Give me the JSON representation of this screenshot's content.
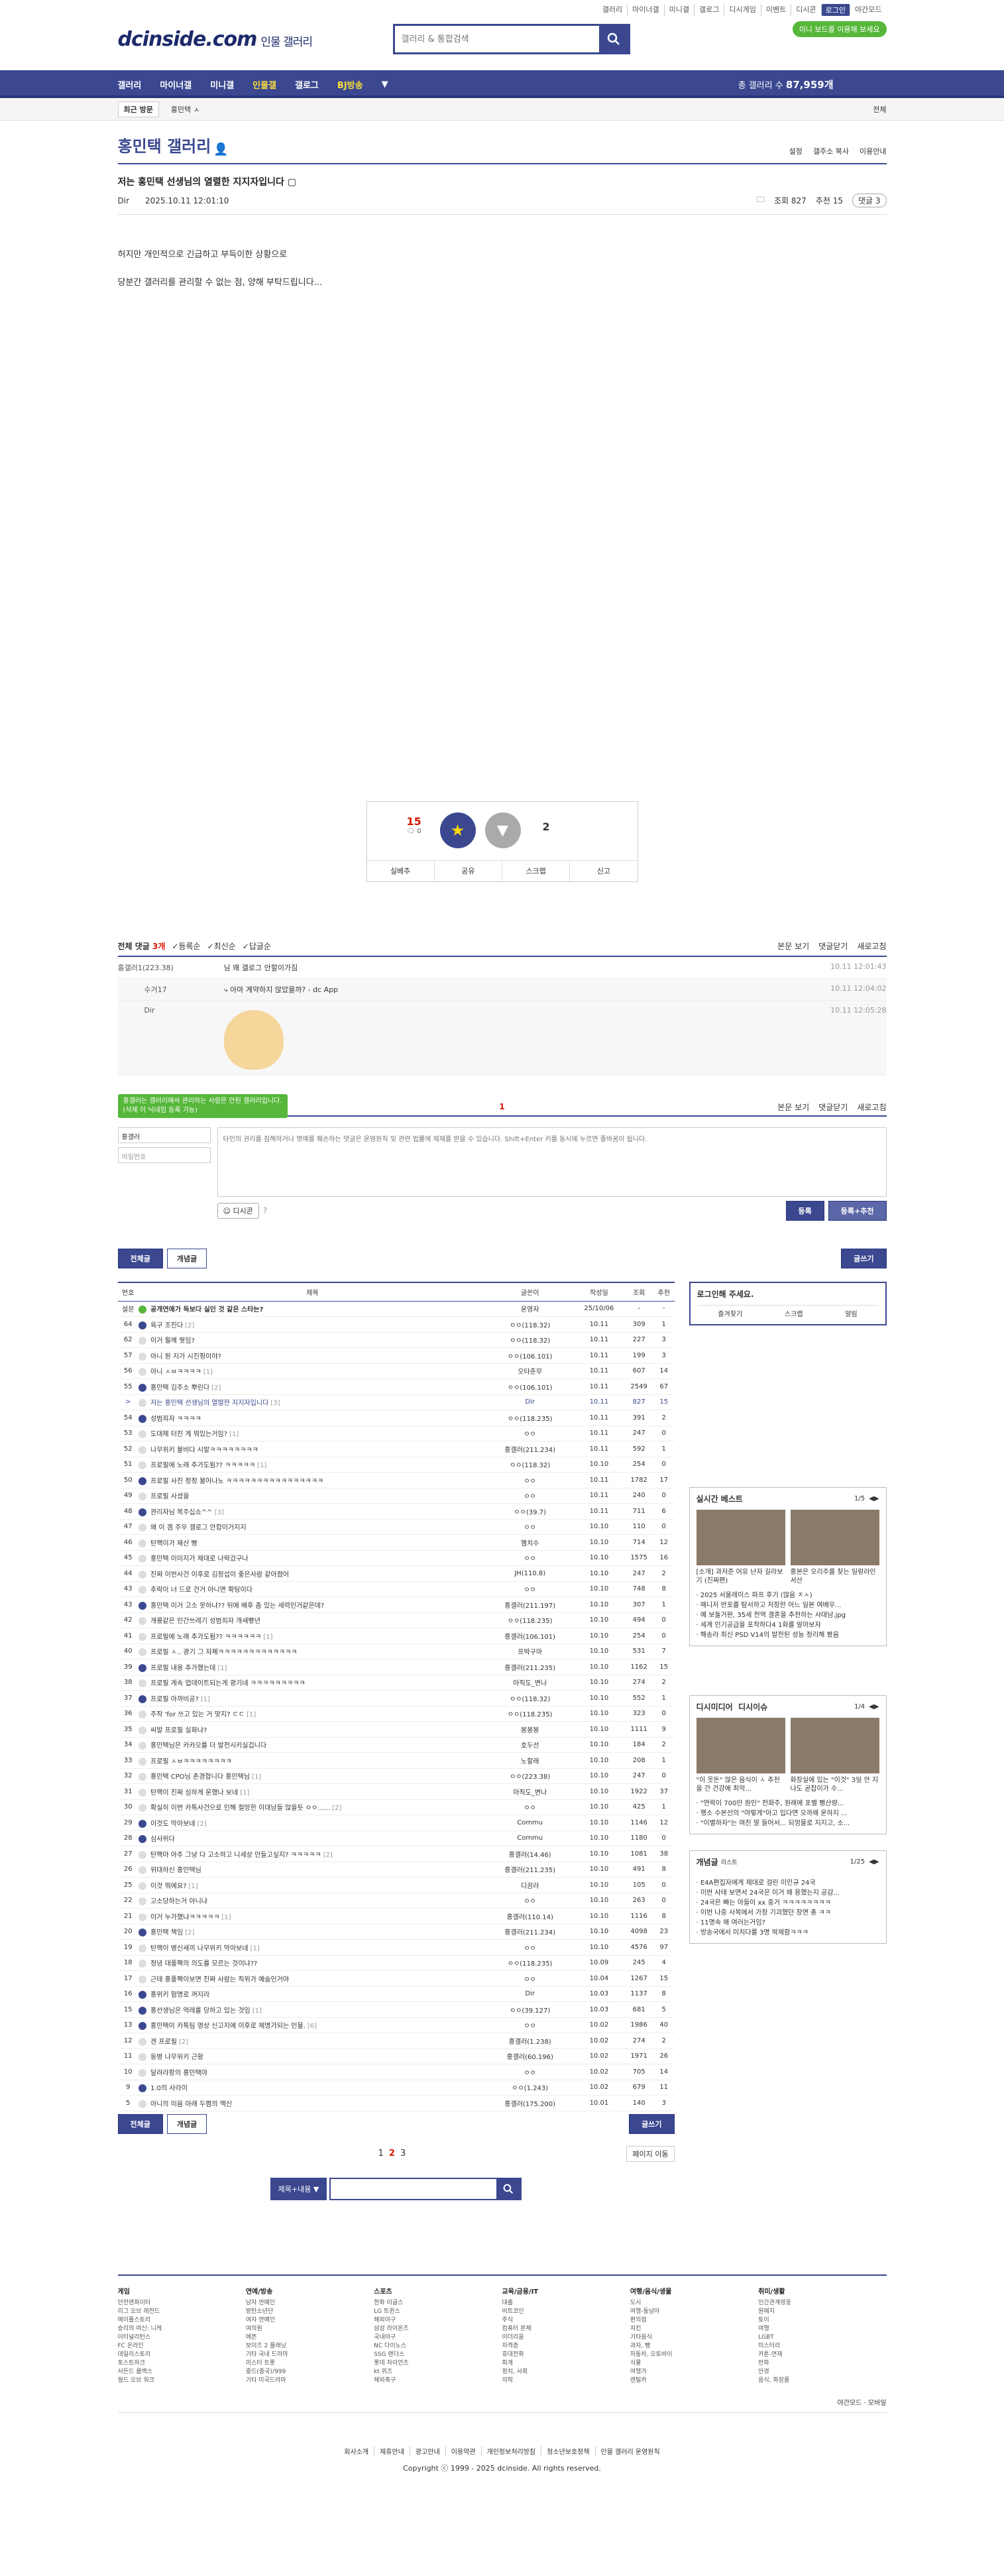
{
  "util_nav": [
    "갤러리",
    "마이너갤",
    "미니갤",
    "갤로그",
    "디시게임",
    "이벤트",
    "디시콘",
    "로그인",
    "야간모드"
  ],
  "logo": {
    "main": "dcinside.com",
    "sub": "인물 갤러리"
  },
  "search": {
    "placeholder": "갤러리 & 통합검색"
  },
  "mini_bubble": "미니 보드를 이용해 보세요",
  "gnb": {
    "items": [
      "갤러리",
      "마이너갤",
      "미니갤",
      "인물갤",
      "갤로그",
      "BJ방송"
    ],
    "count_label": "총 갤러리 수",
    "count_value": "87,959개"
  },
  "visit": {
    "title": "최근 방문",
    "item": "홍민택 ㅅ",
    "all": "전체"
  },
  "gallery": {
    "title": "홍민택 갤러리",
    "opts": [
      "설정",
      "갤주소 복사",
      "이용안내"
    ]
  },
  "post": {
    "title": "저는 홍민택 선생님의 열렬한 지지자입니다",
    "author": "Dir",
    "date": "2025.10.11 12:01:10",
    "views": "조회 827",
    "recommends": "추천 15",
    "comment_btn": "댓글 3",
    "body": [
      "허지만 개인적으로 긴급하고 부득이한 상황으로",
      "당분간 갤러리를 관리할 수 없는 점, 양해 부탁드립니다..."
    ]
  },
  "vote": {
    "up": "15",
    "up_sub": "0",
    "up_label": "개념",
    "down_label": "비추",
    "down": "2",
    "actions": [
      "실베추",
      "공유",
      "스크랩",
      "신고"
    ]
  },
  "comments": {
    "header": "전체 댓글",
    "count": "3개",
    "sorts": [
      "등록순",
      "최신순",
      "답글순"
    ],
    "right": [
      "본문 보기",
      "댓글닫기",
      "새로고침"
    ],
    "items": [
      {
        "who": "홍갤러1(223.38)",
        "text": "님 왜 갤로그 안할이가짐",
        "date": "10.11 12:01:43",
        "reply": false
      },
      {
        "who": "수거17",
        "text": "아마 계약하지 않았을까? - dc App",
        "date": "10.11 12:04:02",
        "reply": true
      },
      {
        "who": "Dir",
        "text": "",
        "date": "10.11 12:05:28",
        "reply": true
      }
    ],
    "page": "1",
    "tip": "홍갤러는 갤러리에서 관리하는 사람은 안된 갤러리입니다. (삭제 이 닉네임 등록 가능)",
    "nick_placeholder": "홍갤러",
    "pw_placeholder": "비밀번호",
    "textarea_placeholder": "타인의 권리를 침해하거나 명예를 훼손하는 댓글은 운영원칙 및 관련 법률에 제재를 받을 수 있습니다. Shift+Enter 키를 동시에 누르면 줄바꿈이 됩니다.",
    "dccon": "디시콘",
    "submit": "등록",
    "submit_rec": "등록+추천"
  },
  "list_buttons": {
    "all": "전체글",
    "concept": "개념글",
    "write": "글쓰기"
  },
  "table": {
    "headers": [
      "번호",
      "제목",
      "글쓴이",
      "작성일",
      "조회",
      "추천"
    ],
    "rows": [
      {
        "no": "설문",
        "title": "공개연애가 득보다 실인 것 같은 스타는?",
        "cc": "",
        "writer": "운영자",
        "date": "25/10/06",
        "views": "-",
        "rec": "-",
        "notice": true,
        "icon": "g"
      },
      {
        "no": "64",
        "title": "육구 조진다",
        "cc": "[2]",
        "writer": "ㅇㅇ(118.32)",
        "date": "10.11",
        "views": "309",
        "rec": "1",
        "icon": "b"
      },
      {
        "no": "62",
        "title": "이거 뭘께 뭣임?",
        "cc": "",
        "writer": "ㅇㅇ(118.32)",
        "date": "10.11",
        "views": "227",
        "rec": "3",
        "icon": ""
      },
      {
        "no": "57",
        "title": "아니 뭔 지가 시진핑이야?",
        "cc": "",
        "writer": "ㅇㅇ(106.101)",
        "date": "10.11",
        "views": "199",
        "rec": "3",
        "icon": ""
      },
      {
        "no": "56",
        "title": "아니 ㅅㅂㅋㅋㅋㅋ",
        "cc": "[1]",
        "writer": "오타춘무",
        "date": "10.11",
        "views": "607",
        "rec": "14",
        "icon": ""
      },
      {
        "no": "55",
        "title": "홍민택 김주소 뿌린다",
        "cc": "[2]",
        "writer": "ㅇㅇ(106.101)",
        "date": "10.11",
        "views": "2549",
        "rec": "67",
        "icon": "b"
      },
      {
        "no": ">",
        "title": "저는 홍민택 선생님의 열렬한 지지자입니다",
        "cc": "[3]",
        "writer": "Dir",
        "date": "10.11",
        "views": "827",
        "rec": "15",
        "cur": true,
        "icon": ""
      },
      {
        "no": "54",
        "title": "성범죄자 ㅋㅋㅋㅋ",
        "cc": "",
        "writer": "ㅇㅇ(118.235)",
        "date": "10.11",
        "views": "391",
        "rec": "2",
        "icon": "b"
      },
      {
        "no": "53",
        "title": "도대체 터진 게 뭐있는거임?",
        "cc": "[1]",
        "writer": "ㅇㅇ",
        "date": "10.11",
        "views": "247",
        "rec": "0",
        "icon": ""
      },
      {
        "no": "52",
        "title": "나무위키 불비다 시발ㅋㅋㅋㅋㅋㅋㅋㅋ",
        "cc": "",
        "writer": "홍갤러(211.234)",
        "date": "10.11",
        "views": "592",
        "rec": "1",
        "icon": ""
      },
      {
        "no": "51",
        "title": "프로필에 노래 추가도됨?? ㅋㅋㅋㅋㅋ",
        "cc": "[1]",
        "writer": "ㅇㅇ(118.32)",
        "date": "10.10",
        "views": "254",
        "rec": "0",
        "icon": ""
      },
      {
        "no": "50",
        "title": "프로필 사진 정정 불어나노 ㅋㅋㅋㅋㅋㅋㅋㅋㅋㅋㅋㅋㅋㅋㅋㅋ",
        "cc": "",
        "writer": "ㅇㅇ",
        "date": "10.11",
        "views": "1782",
        "rec": "17",
        "icon": "b"
      },
      {
        "no": "49",
        "title": "프로필 사셨을",
        "cc": "",
        "writer": "ㅇㅇ",
        "date": "10.11",
        "views": "240",
        "rec": "0",
        "icon": ""
      },
      {
        "no": "48",
        "title": "관리자님 복주십쇼^^",
        "cc": "[3]",
        "writer": "ㅇㅇ(39.7)",
        "date": "10.11",
        "views": "711",
        "rec": "6",
        "icon": "b"
      },
      {
        "no": "47",
        "title": "왜 이 겜 주우 갤로그 안합이거지지",
        "cc": "",
        "writer": "ㅇㅇ",
        "date": "10.10",
        "views": "110",
        "rec": "0",
        "icon": ""
      },
      {
        "no": "46",
        "title": "탄핵이가 재산 빵",
        "cc": "",
        "writer": "햄치수",
        "date": "10.10",
        "views": "714",
        "rec": "12",
        "icon": ""
      },
      {
        "no": "45",
        "title": "홍민택 이미지가 제대로 나락갔구나",
        "cc": "",
        "writer": "ㅇㅇ",
        "date": "10.10",
        "views": "1575",
        "rec": "16",
        "icon": ""
      },
      {
        "no": "44",
        "title": "진짜 이번사건 이후로 김정섭이 좋은사람 같아졌어",
        "cc": "",
        "writer": "JH(110.8)",
        "date": "10.10",
        "views": "247",
        "rec": "2",
        "icon": ""
      },
      {
        "no": "43",
        "title": "추락이 너 드로 건거 아니면 확팅이다",
        "cc": "",
        "writer": "ㅇㅇ",
        "date": "10.10",
        "views": "748",
        "rec": "8",
        "icon": ""
      },
      {
        "no": "43",
        "title": "홍민택 이거 고소 못하냐?? 뒤에 배후 좀 있는 세력인거같은데?",
        "cc": "",
        "writer": "홍갤러(211.197)",
        "date": "10.10",
        "views": "307",
        "rec": "1",
        "icon": "b"
      },
      {
        "no": "42",
        "title": "개룡같은 인간쓰레기 성범죄자 개새빵년",
        "cc": "",
        "writer": "ㅇㅇ(118.235)",
        "date": "10.10",
        "views": "494",
        "rec": "0",
        "icon": ""
      },
      {
        "no": "41",
        "title": "프로필에 노래 추가도됨?? ㅋㅋㅋㅋㅋㅋ",
        "cc": "[1]",
        "writer": "홍갤러(106.101)",
        "date": "10.10",
        "views": "254",
        "rec": "0",
        "icon": ""
      },
      {
        "no": "40",
        "title": "프로필 ㅅ.. 광기 그 자체ㅋㅋㅋㅋㅋㅋㅋㅋㅋㅋㅋㅋㅋ",
        "cc": "",
        "writer": "프박구마",
        "date": "10.10",
        "views": "531",
        "rec": "7",
        "icon": ""
      },
      {
        "no": "39",
        "title": "프로필 내용 추가했는데",
        "cc": "[1]",
        "writer": "홍갤러(211.235)",
        "date": "10.10",
        "views": "1162",
        "rec": "15",
        "icon": "b"
      },
      {
        "no": "38",
        "title": "프로필 게속 업데이트되는게 광기네 ㅋㅋㅋㅋㅋㅋㅋㅋㅋ",
        "cc": "",
        "writer": "아직도_변나",
        "date": "10.10",
        "views": "274",
        "rec": "2",
        "icon": ""
      },
      {
        "no": "37",
        "title": "프로필 아까비공?",
        "cc": "[1]",
        "writer": "ㅇㅇ(118.32)",
        "date": "10.10",
        "views": "552",
        "rec": "1",
        "icon": "b"
      },
      {
        "no": "36",
        "title": "주작 'for 쓰고 있는 거 맞지? ㄷㄷ",
        "cc": "[1]",
        "writer": "ㅇㅇ(118.235)",
        "date": "10.10",
        "views": "323",
        "rec": "0",
        "icon": ""
      },
      {
        "no": "35",
        "title": "씨발 프로필 실화냐?",
        "cc": "",
        "writer": "봉봉봉",
        "date": "10.10",
        "views": "1111",
        "rec": "9",
        "icon": ""
      },
      {
        "no": "34",
        "title": "홍민택님은 카카오를 더 발전시키실겁니다",
        "cc": "",
        "writer": "호두선",
        "date": "10.10",
        "views": "184",
        "rec": "2",
        "icon": ""
      },
      {
        "no": "33",
        "title": "프로필 ㅅㅂㅋㅋㅋㅋㅋㅋㅋㅋ",
        "cc": "",
        "writer": "노할래",
        "date": "10.10",
        "views": "208",
        "rec": "1",
        "icon": ""
      },
      {
        "no": "32",
        "title": "홍민택 CPO님 존경합니다 홍민택님",
        "cc": "[1]",
        "writer": "ㅇㅇ(223.38)",
        "date": "10.10",
        "views": "247",
        "rec": "0",
        "icon": ""
      },
      {
        "no": "31",
        "title": "탄핵이 진짜 심하게 운했나 보네",
        "cc": "[1]",
        "writer": "아직도_변나",
        "date": "10.10",
        "views": "1922",
        "rec": "37",
        "icon": ""
      },
      {
        "no": "30",
        "title": "확실히 이번 카톡사건으로 인해 절망한 이대남들 많을듯 ㅇㅇ......",
        "cc": "[2]",
        "writer": "ㅇㅇ",
        "date": "10.10",
        "views": "425",
        "rec": "1",
        "icon": ""
      },
      {
        "no": "29",
        "title": "이것도 막아보네",
        "cc": "[2]",
        "writer": "Commu",
        "date": "10.10",
        "views": "1146",
        "rec": "12",
        "icon": "b"
      },
      {
        "no": "28",
        "title": "심사위다",
        "cc": "",
        "writer": "Commu",
        "date": "10.10",
        "views": "1180",
        "rec": "0",
        "icon": "b"
      },
      {
        "no": "27",
        "title": "탄핵아 아주 그냥 다 고소하고 니세상 만들고싶지? ㅋㅋㅋㅋㅋ",
        "cc": "[2]",
        "writer": "홍갤러(14.46)",
        "date": "10.10",
        "views": "1081",
        "rec": "38",
        "icon": ""
      },
      {
        "no": "26",
        "title": "위대하신 홍민택님",
        "cc": "",
        "writer": "홍갤러(211.235)",
        "date": "10.10",
        "views": "491",
        "rec": "8",
        "icon": ""
      },
      {
        "no": "25",
        "title": "이것 뭐에요?",
        "cc": "[1]",
        "writer": "디끔라",
        "date": "10.10",
        "views": "105",
        "rec": "0",
        "icon": ""
      },
      {
        "no": "22",
        "title": "고소당하는거 아니냐",
        "cc": "",
        "writer": "ㅇㅇ",
        "date": "10.10",
        "views": "263",
        "rec": "0",
        "icon": ""
      },
      {
        "no": "21",
        "title": "이거 누가했냐ㅋㅋㅋㅋㅋ",
        "cc": "[1]",
        "writer": "홍갤러(110.14)",
        "date": "10.10",
        "views": "1116",
        "rec": "8",
        "icon": ""
      },
      {
        "no": "20",
        "title": "홍민택 책임",
        "cc": "[2]",
        "writer": "홍갤러(211.234)",
        "date": "10.10",
        "views": "4098",
        "rec": "23",
        "icon": "b"
      },
      {
        "no": "19",
        "title": "탄핵이 병신새끼 나무위키 막아보네",
        "cc": "[1]",
        "writer": "ㅇㅇ",
        "date": "10.10",
        "views": "4576",
        "rec": "97",
        "icon": ""
      },
      {
        "no": "18",
        "title": "정녕 대플팩의 의도를 모르는 것이냐??",
        "cc": "",
        "writer": "ㅇㅇ(118.235)",
        "date": "10.09",
        "views": "245",
        "rec": "4",
        "icon": ""
      },
      {
        "no": "17",
        "title": "근데 홍플팩이보면 진짜 사람는 직위가 예술인거야",
        "cc": "",
        "writer": "ㅇㅇ",
        "date": "10.04",
        "views": "1267",
        "rec": "15",
        "icon": ""
      },
      {
        "no": "16",
        "title": "홍위키 험명로 꺼지라",
        "cc": "",
        "writer": "Dir",
        "date": "10.03",
        "views": "1137",
        "rec": "8",
        "icon": "b"
      },
      {
        "no": "15",
        "title": "홍선생님은 억레를 당하고 있는 것임",
        "cc": "[1]",
        "writer": "ㅇㅇ(39.127)",
        "date": "10.03",
        "views": "681",
        "rec": "5",
        "icon": "b"
      },
      {
        "no": "13",
        "title": "홍민택이 카톡팀 영상 신고지에 이후로 제명가되는 인물.",
        "cc": "[6]",
        "writer": "ㅇㅇ",
        "date": "10.02",
        "views": "1986",
        "rec": "40",
        "icon": "b"
      },
      {
        "no": "12",
        "title": "겐 프로필",
        "cc": "[2]",
        "writer": "홍갤러(1.238)",
        "date": "10.02",
        "views": "274",
        "rec": "2",
        "icon": ""
      },
      {
        "no": "11",
        "title": "동병 나무위키 근황",
        "cc": "",
        "writer": "홍갤러(60.196)",
        "date": "10.02",
        "views": "1971",
        "rec": "26",
        "icon": ""
      },
      {
        "no": "10",
        "title": "달려라팡의 홍민택야",
        "cc": "",
        "writer": "ㅇㅇ",
        "date": "10.02",
        "views": "705",
        "rec": "14",
        "icon": ""
      },
      {
        "no": "9",
        "title": "1.0의 사라이",
        "cc": "",
        "writer": "ㅇㅇ(1.243)",
        "date": "10.02",
        "views": "679",
        "rec": "11",
        "icon": "b"
      },
      {
        "no": "5",
        "title": "아니의 미음 아래 두쩜의 맥신",
        "cc": "",
        "writer": "홍갤러(175.200)",
        "date": "10.01",
        "views": "140",
        "rec": "3",
        "icon": ""
      }
    ]
  },
  "side": {
    "login_title": "로그인해 주세요.",
    "login_links": [
      "즐겨찾기",
      "스크랩",
      "알림"
    ],
    "realtime": {
      "title": "실시간 베스트",
      "page": "1/5",
      "thumbs": [
        "[소개] 과저준 어유 난자 길라보기 (진짜편)",
        "홍본은 오리주를 찾는 일렁라인 서산"
      ],
      "items": [
        "2025 서울레이스 파프 후기 (많음 ㅈㅅ)",
        "매니저 반포를 탐서하고 저장한 어느 일본 여배우...",
        "예 보돌거판, 35세 전역 결혼을 추천하는 사대남.jpg",
        "세계 인기공급을 포착하다4 1화를 알아보자",
        "해송라 최신 PSD V14의 발전된 성능 정리해 봤음"
      ]
    },
    "dcmedia": {
      "title": "디시미디어",
      "title2": "디시이슈",
      "page": "1/4",
      "thumbs": [
        "\"이 웃돈\" 많은 음식이 ㅅ 추천을 간 건강에 최악...",
        "화장실에 있는 \"이것\" 3일 안 지나도 곧잡이가 수..."
      ],
      "items": [
        "\"연락이 700만 원인\" 전화주, 원래에 포벨 뻥산량...",
        "행소 수본선의 \"야렇게\"아고 입다면 오까왜 운하지 ...",
        "\"이별하자\"는 여친 말 들어서... 되엉물로 지지고, 소..."
      ]
    },
    "concept": {
      "title": "개념글",
      "sub": "리스트",
      "page": "1/25",
      "items": [
        "E4A편집자에게 제대로 걸린 이민규 24국",
        "이번 사태 보면서 24국은 이거 왜 용했는지 공감...",
        "24국은 빠는 아들이 xx 중거 ㅋㅋㅋㅋㅋㅋㅋㅋ",
        "이번 나중 사복에서 가장 기괴했던 장면 총 ㅋㅋ",
        "11명속 왜 여러는거임?",
        "방송국에서 미치다를 3명 박제함ㅋㅋㅋ"
      ]
    }
  },
  "paging": {
    "pages": [
      "1",
      "2",
      "3"
    ],
    "current": "2",
    "jump": "페이지 이동"
  },
  "bottom_search": {
    "select": "제목+내용"
  },
  "footer": {
    "cols": [
      {
        "title": "게임",
        "items": [
          "던전앤파이터",
          "리그 오브 레전드",
          "메이플스토리",
          "승리의 여신: 니케",
          "이터널리턴스",
          "FC 온라인",
          "데일리스토리",
          "포스트하크",
          "서든드 롭백스",
          "월드 오브 워크"
        ]
      },
      {
        "title": "연예/방송",
        "items": [
          "남자 연예인",
          "방탄소년단",
          "여자 연예인",
          "여의원",
          "에픈",
          "보이즈 2 플래닛",
          "기타 국내 드라마",
          "미스터 트롯",
          "중드(중국)/999",
          "기타 미국드라마"
        ]
      },
      {
        "title": "스포츠",
        "items": [
          "한화 이글스",
          "LG 트윈스",
          "해외야구",
          "삼성 라이온즈",
          "국내야구",
          "NC 다이노스",
          "SSG 랜더스",
          "롯데 자이언츠",
          "kt 위즈",
          "해외축구"
        ]
      },
      {
        "title": "교육/금융/IT",
        "items": [
          "대출",
          "비트코인",
          "주식",
          "컴퓨터 본체",
          "이더리움",
          "자격증",
          "휴대전화",
          "회계",
          "정치, 사회",
          "의학"
        ]
      },
      {
        "title": "여행/음식/생물",
        "items": [
          "도시",
          "여행-동남아",
          "편의점",
          "치킨",
          "기타음식",
          "과자, 빵",
          "자동차, 오토바이",
          "식물",
          "여행가",
          "렌털카"
        ]
      },
      {
        "title": "취미/생활",
        "items": [
          "인간관계영웅",
          "원예지",
          "토이",
          "여행",
          "LGBT",
          "미스터리",
          "카툰-연재",
          "만화",
          "안경",
          "음식, 화장품"
        ]
      }
    ],
    "night_mode": "야간모드",
    "mobile": "모바일",
    "links": [
      "회사소개",
      "제휴안내",
      "광고안내",
      "이용약관",
      "개인정보처리방침",
      "청소년보호정책",
      "인물 갤러리 운영원칙"
    ],
    "copyright": "Copyright ⓒ 1999 - 2025 dcinside. All rights reserved."
  }
}
